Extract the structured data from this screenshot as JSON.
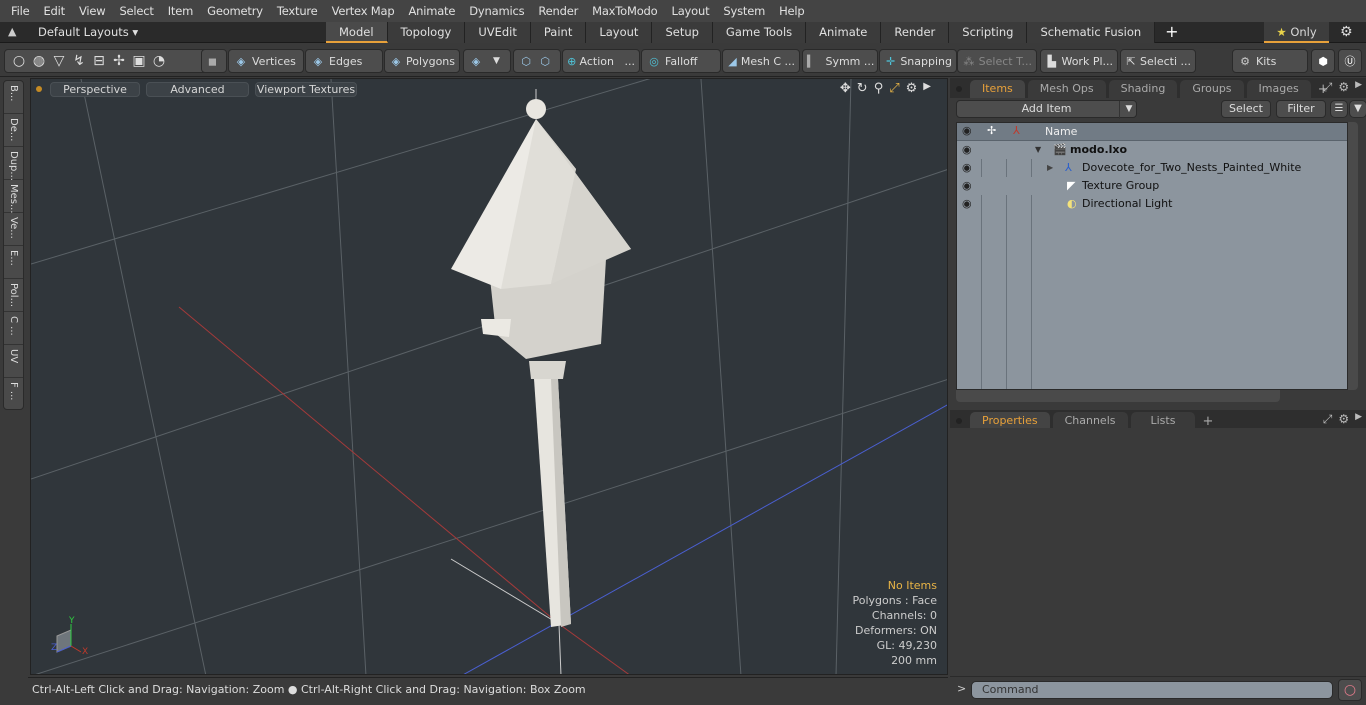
{
  "menu": [
    "File",
    "Edit",
    "View",
    "Select",
    "Item",
    "Geometry",
    "Texture",
    "Vertex Map",
    "Animate",
    "Dynamics",
    "Render",
    "MaxToModo",
    "Layout",
    "System",
    "Help"
  ],
  "layout_selector": "Default Layouts ▾",
  "layout_tabs": [
    {
      "label": "Model",
      "active": true
    },
    {
      "label": "Topology"
    },
    {
      "label": "UVEdit"
    },
    {
      "label": "Paint"
    },
    {
      "label": "Layout"
    },
    {
      "label": "Setup"
    },
    {
      "label": "Game Tools"
    },
    {
      "label": "Animate"
    },
    {
      "label": "Render"
    },
    {
      "label": "Scripting"
    },
    {
      "label": "Schematic Fusion"
    }
  ],
  "only_label": "Only",
  "toolbar": {
    "vertices": "Vertices",
    "edges": "Edges",
    "polygons": "Polygons",
    "action": "Action",
    "action_more": "...",
    "falloff": "Falloff",
    "meshc": "Mesh C ...",
    "symm": "Symm ...",
    "snapping": "Snapping",
    "selectt": "Select T...",
    "workpl": "Work Pl...",
    "selecti": "Selecti ...",
    "kits": "Kits"
  },
  "left_tabs": [
    "B...",
    "De...",
    "Dup...",
    "Mes...",
    "Ve...",
    "E...",
    "Pol...",
    "C ...",
    "UV",
    "F ..."
  ],
  "viewport": {
    "view": "Perspective",
    "shading": "Advanced",
    "textures": "Viewport Textures",
    "info": {
      "selection": "No Items",
      "polygons": "Polygons : Face",
      "channels": "Channels: 0",
      "deformers": "Deformers: ON",
      "gl": "GL: 49,230",
      "scale": "200 mm"
    },
    "axes": {
      "x": "X",
      "y": "Y",
      "z": "Z",
      "x_color": "#c0392b",
      "y_color": "#2ecc40",
      "z_color": "#4a5fd0"
    }
  },
  "status": "Ctrl-Alt-Left Click and Drag: Navigation: Zoom ● Ctrl-Alt-Right Click and Drag: Navigation: Box Zoom",
  "items_panel": {
    "tabs": [
      {
        "label": "Items",
        "active": true
      },
      {
        "label": "Mesh Ops"
      },
      {
        "label": "Shading"
      },
      {
        "label": "Groups"
      },
      {
        "label": "Images"
      }
    ],
    "add_item": "Add Item",
    "select": "Select",
    "filter": "Filter",
    "name_header": "Name",
    "rows": [
      {
        "name": "modo.lxo",
        "bold": true
      },
      {
        "name": "Dovecote_for_Two_Nests_Painted_White"
      },
      {
        "name": "Texture Group"
      },
      {
        "name": "Directional Light"
      }
    ]
  },
  "props_panel": {
    "tabs": [
      {
        "label": "Properties",
        "active": true
      },
      {
        "label": "Channels"
      },
      {
        "label": "Lists"
      }
    ]
  },
  "command": {
    "placeholder": "Command",
    "prompt": ">"
  },
  "colors": {
    "accent": "#e8a13a",
    "viewport_bg": "#30363b"
  }
}
